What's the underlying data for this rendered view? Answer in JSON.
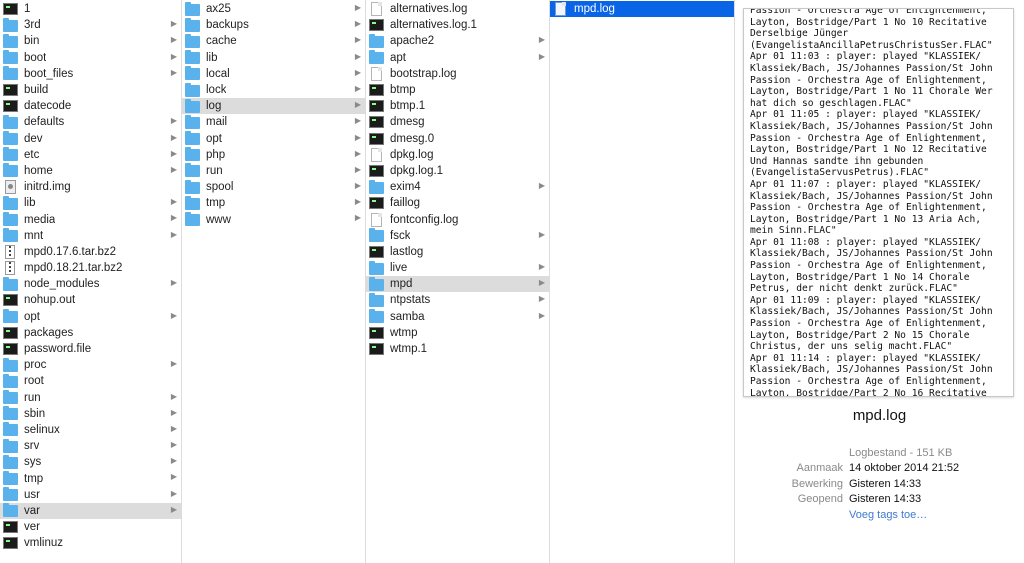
{
  "columns": [
    {
      "items": [
        {
          "label": "1",
          "icon": "terminal-icon",
          "arrow": false,
          "state": ""
        },
        {
          "label": "3rd",
          "icon": "folder-icon",
          "arrow": true,
          "state": ""
        },
        {
          "label": "bin",
          "icon": "folder-icon",
          "arrow": true,
          "state": ""
        },
        {
          "label": "boot",
          "icon": "folder-icon",
          "arrow": true,
          "state": ""
        },
        {
          "label": "boot_files",
          "icon": "folder-icon",
          "arrow": true,
          "state": ""
        },
        {
          "label": "build",
          "icon": "terminal-icon",
          "arrow": false,
          "state": ""
        },
        {
          "label": "datecode",
          "icon": "terminal-icon",
          "arrow": false,
          "state": ""
        },
        {
          "label": "defaults",
          "icon": "folder-icon",
          "arrow": true,
          "state": ""
        },
        {
          "label": "dev",
          "icon": "folder-icon",
          "arrow": true,
          "state": ""
        },
        {
          "label": "etc",
          "icon": "folder-icon",
          "arrow": true,
          "state": ""
        },
        {
          "label": "home",
          "icon": "folder-icon",
          "arrow": true,
          "state": ""
        },
        {
          "label": "initrd.img",
          "icon": "disk-image-icon",
          "arrow": false,
          "state": ""
        },
        {
          "label": "lib",
          "icon": "folder-icon",
          "arrow": true,
          "state": ""
        },
        {
          "label": "media",
          "icon": "folder-icon",
          "arrow": true,
          "state": ""
        },
        {
          "label": "mnt",
          "icon": "folder-icon",
          "arrow": true,
          "state": ""
        },
        {
          "label": "mpd0.17.6.tar.bz2",
          "icon": "archive-icon",
          "arrow": false,
          "state": ""
        },
        {
          "label": "mpd0.18.21.tar.bz2",
          "icon": "archive-icon",
          "arrow": false,
          "state": ""
        },
        {
          "label": "node_modules",
          "icon": "folder-icon",
          "arrow": true,
          "state": ""
        },
        {
          "label": "nohup.out",
          "icon": "terminal-icon",
          "arrow": false,
          "state": ""
        },
        {
          "label": "opt",
          "icon": "folder-icon",
          "arrow": true,
          "state": ""
        },
        {
          "label": "packages",
          "icon": "terminal-icon",
          "arrow": false,
          "state": ""
        },
        {
          "label": "password.file",
          "icon": "terminal-icon",
          "arrow": false,
          "state": ""
        },
        {
          "label": "proc",
          "icon": "folder-icon",
          "arrow": true,
          "state": ""
        },
        {
          "label": "root",
          "icon": "folder-icon",
          "arrow": false,
          "state": ""
        },
        {
          "label": "run",
          "icon": "folder-icon",
          "arrow": true,
          "state": ""
        },
        {
          "label": "sbin",
          "icon": "folder-icon",
          "arrow": true,
          "state": ""
        },
        {
          "label": "selinux",
          "icon": "folder-icon",
          "arrow": true,
          "state": ""
        },
        {
          "label": "srv",
          "icon": "folder-icon",
          "arrow": true,
          "state": ""
        },
        {
          "label": "sys",
          "icon": "folder-icon",
          "arrow": true,
          "state": ""
        },
        {
          "label": "tmp",
          "icon": "folder-icon",
          "arrow": true,
          "state": ""
        },
        {
          "label": "usr",
          "icon": "folder-icon",
          "arrow": true,
          "state": ""
        },
        {
          "label": "var",
          "icon": "folder-icon",
          "arrow": true,
          "state": "path-selected"
        },
        {
          "label": "ver",
          "icon": "terminal-icon",
          "arrow": false,
          "state": ""
        },
        {
          "label": "vmlinuz",
          "icon": "terminal-icon",
          "arrow": false,
          "state": ""
        }
      ]
    },
    {
      "items": [
        {
          "label": "ax25",
          "icon": "folder-icon",
          "arrow": true,
          "state": ""
        },
        {
          "label": "backups",
          "icon": "folder-icon",
          "arrow": true,
          "state": ""
        },
        {
          "label": "cache",
          "icon": "folder-icon",
          "arrow": true,
          "state": ""
        },
        {
          "label": "lib",
          "icon": "folder-icon",
          "arrow": true,
          "state": ""
        },
        {
          "label": "local",
          "icon": "folder-icon",
          "arrow": true,
          "state": ""
        },
        {
          "label": "lock",
          "icon": "folder-icon",
          "arrow": true,
          "state": ""
        },
        {
          "label": "log",
          "icon": "folder-icon",
          "arrow": true,
          "state": "path-selected"
        },
        {
          "label": "mail",
          "icon": "folder-icon",
          "arrow": true,
          "state": ""
        },
        {
          "label": "opt",
          "icon": "folder-icon",
          "arrow": true,
          "state": ""
        },
        {
          "label": "php",
          "icon": "folder-icon",
          "arrow": true,
          "state": ""
        },
        {
          "label": "run",
          "icon": "folder-icon",
          "arrow": true,
          "state": ""
        },
        {
          "label": "spool",
          "icon": "folder-icon",
          "arrow": true,
          "state": ""
        },
        {
          "label": "tmp",
          "icon": "folder-icon",
          "arrow": true,
          "state": ""
        },
        {
          "label": "www",
          "icon": "folder-icon",
          "arrow": true,
          "state": ""
        }
      ]
    },
    {
      "items": [
        {
          "label": "alternatives.log",
          "icon": "document-icon",
          "arrow": false,
          "state": ""
        },
        {
          "label": "alternatives.log.1",
          "icon": "terminal-icon",
          "arrow": false,
          "state": ""
        },
        {
          "label": "apache2",
          "icon": "folder-icon",
          "arrow": true,
          "state": ""
        },
        {
          "label": "apt",
          "icon": "folder-icon",
          "arrow": true,
          "state": ""
        },
        {
          "label": "bootstrap.log",
          "icon": "document-icon",
          "arrow": false,
          "state": ""
        },
        {
          "label": "btmp",
          "icon": "terminal-icon",
          "arrow": false,
          "state": ""
        },
        {
          "label": "btmp.1",
          "icon": "terminal-icon",
          "arrow": false,
          "state": ""
        },
        {
          "label": "dmesg",
          "icon": "terminal-icon",
          "arrow": false,
          "state": ""
        },
        {
          "label": "dmesg.0",
          "icon": "terminal-icon",
          "arrow": false,
          "state": ""
        },
        {
          "label": "dpkg.log",
          "icon": "document-icon",
          "arrow": false,
          "state": ""
        },
        {
          "label": "dpkg.log.1",
          "icon": "terminal-icon",
          "arrow": false,
          "state": ""
        },
        {
          "label": "exim4",
          "icon": "folder-icon",
          "arrow": true,
          "state": ""
        },
        {
          "label": "faillog",
          "icon": "terminal-icon",
          "arrow": false,
          "state": ""
        },
        {
          "label": "fontconfig.log",
          "icon": "document-icon",
          "arrow": false,
          "state": ""
        },
        {
          "label": "fsck",
          "icon": "folder-icon",
          "arrow": true,
          "state": ""
        },
        {
          "label": "lastlog",
          "icon": "terminal-icon",
          "arrow": false,
          "state": ""
        },
        {
          "label": "live",
          "icon": "folder-icon",
          "arrow": true,
          "state": ""
        },
        {
          "label": "mpd",
          "icon": "folder-icon",
          "arrow": true,
          "state": "path-selected"
        },
        {
          "label": "ntpstats",
          "icon": "folder-icon",
          "arrow": true,
          "state": ""
        },
        {
          "label": "samba",
          "icon": "folder-icon",
          "arrow": true,
          "state": ""
        },
        {
          "label": "wtmp",
          "icon": "terminal-icon",
          "arrow": false,
          "state": ""
        },
        {
          "label": "wtmp.1",
          "icon": "terminal-icon",
          "arrow": false,
          "state": ""
        }
      ]
    },
    {
      "items": [
        {
          "label": "mpd.log",
          "icon": "document-icon",
          "arrow": false,
          "state": "active"
        }
      ]
    }
  ],
  "preview": {
    "text": "Passion - Orchestra Age of Enlightenment,\nLayton, Bostridge/Part 1 No 10 Recitative\nDerselbige Jünger\n(EvangelistaAncillaPetrusChristusSer.FLAC\"\nApr 01 11:03 : player: played \"KLASSIEK/\nKlassiek/Bach, JS/Johannes Passion/St John\nPassion - Orchestra Age of Enlightenment,\nLayton, Bostridge/Part 1 No 11 Chorale Wer\nhat dich so geschlagen.FLAC\"\nApr 01 11:05 : player: played \"KLASSIEK/\nKlassiek/Bach, JS/Johannes Passion/St John\nPassion - Orchestra Age of Enlightenment,\nLayton, Bostridge/Part 1 No 12 Recitative\nUnd Hannas sandte ihn gebunden\n(EvangelistaServusPetrus).FLAC\"\nApr 01 11:07 : player: played \"KLASSIEK/\nKlassiek/Bach, JS/Johannes Passion/St John\nPassion - Orchestra Age of Enlightenment,\nLayton, Bostridge/Part 1 No 13 Aria Ach,\nmein Sinn.FLAC\"\nApr 01 11:08 : player: played \"KLASSIEK/\nKlassiek/Bach, JS/Johannes Passion/St John\nPassion - Orchestra Age of Enlightenment,\nLayton, Bostridge/Part 1 No 14 Chorale\nPetrus, der nicht denkt zurück.FLAC\"\nApr 01 11:09 : player: played \"KLASSIEK/\nKlassiek/Bach, JS/Johannes Passion/St John\nPassion - Orchestra Age of Enlightenment,\nLayton, Bostridge/Part 2 No 15 Chorale\nChristus, der uns selig macht.FLAC\"\nApr 01 11:14 : player: played \"KLASSIEK/\nKlassiek/Bach, JS/Johannes Passion/St John\nPassion - Orchestra Age of Enlightenment,\nLayton, Bostridge/Part 2 No 16 Recitative",
    "file_name": "mpd.log",
    "kind": "Logbestand - 151 KB",
    "created_label": "Aanmaak",
    "created_value": "14 oktober 2014 21:52",
    "modified_label": "Bewerking",
    "modified_value": "Gisteren 14:33",
    "opened_label": "Geopend",
    "opened_value": "Gisteren 14:33",
    "add_tags": "Voeg tags toe…"
  },
  "colors": {
    "selection_active": "#0a64e6",
    "selection_path": "#dcdcdc",
    "folder": "#5ab2ec",
    "link": "#3f7ad1"
  }
}
